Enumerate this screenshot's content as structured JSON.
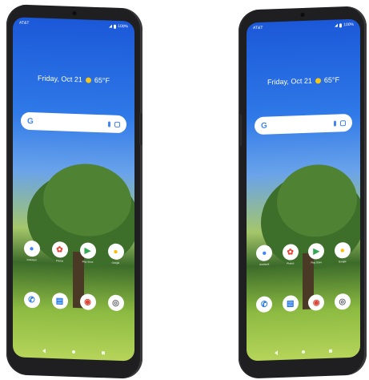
{
  "phones": [
    {
      "carrier": "AT&T",
      "status_right": "100%",
      "date_text": "Friday, Oct 21",
      "temperature": "65°F",
      "search_logo": "G",
      "app_row": [
        {
          "name": "Assistant",
          "icon": "assistant-icon",
          "glyph": "●",
          "color": "#4285f4"
        },
        {
          "name": "Photos",
          "icon": "photos-icon",
          "glyph": "✿",
          "color": "#ea4335"
        },
        {
          "name": "Play Store",
          "icon": "play-store-icon",
          "glyph": "▶",
          "color": "#34a853"
        },
        {
          "name": "Google",
          "icon": "google-apps-icon",
          "glyph": "●",
          "color": "#fbbc05"
        }
      ],
      "dock": [
        {
          "name": "Phone",
          "icon": "phone-icon",
          "glyph": "✆",
          "color": "#1a73e8"
        },
        {
          "name": "Messages",
          "icon": "messages-icon",
          "glyph": "▤",
          "color": "#1a73e8"
        },
        {
          "name": "Chrome",
          "icon": "chrome-icon",
          "glyph": "◉",
          "color": "#db4437"
        },
        {
          "name": "Camera",
          "icon": "camera-icon",
          "glyph": "◎",
          "color": "#5f6368"
        }
      ]
    },
    {
      "carrier": "AT&T",
      "status_right": "100%",
      "date_text": "Friday, Oct 21",
      "temperature": "65°F",
      "search_logo": "G",
      "app_row": [
        {
          "name": "Assistant",
          "icon": "assistant-icon",
          "glyph": "●",
          "color": "#4285f4"
        },
        {
          "name": "Photos",
          "icon": "photos-icon",
          "glyph": "✿",
          "color": "#ea4335"
        },
        {
          "name": "Play Store",
          "icon": "play-store-icon",
          "glyph": "▶",
          "color": "#34a853"
        },
        {
          "name": "Google",
          "icon": "google-apps-icon",
          "glyph": "●",
          "color": "#fbbc05"
        }
      ],
      "dock": [
        {
          "name": "Phone",
          "icon": "phone-icon",
          "glyph": "✆",
          "color": "#1a73e8"
        },
        {
          "name": "Messages",
          "icon": "messages-icon",
          "glyph": "▤",
          "color": "#1a73e8"
        },
        {
          "name": "Chrome",
          "icon": "chrome-icon",
          "glyph": "◉",
          "color": "#db4437"
        },
        {
          "name": "Camera",
          "icon": "camera-icon",
          "glyph": "◎",
          "color": "#5f6368"
        }
      ]
    }
  ]
}
